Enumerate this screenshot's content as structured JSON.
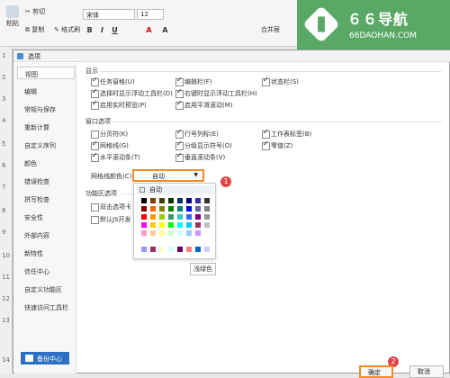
{
  "ribbon": {
    "paste": "粘贴",
    "cut": "剪切",
    "copy": "复制",
    "format_painter": "格式刷",
    "font": "宋体",
    "font_size": "12",
    "format_buttons": [
      "B",
      "I",
      "U",
      "A",
      "A"
    ],
    "merge_center": "合并居"
  },
  "watermark": {
    "title": "６６导航",
    "subtitle": "66DAOHAN.COM"
  },
  "row_numbers": [
    "1",
    "2",
    "3",
    "4",
    "5",
    "6",
    "7",
    "8",
    "9",
    "10",
    "11",
    "12",
    "13",
    "14"
  ],
  "dialog": {
    "title": "选项",
    "sidebar": [
      "视图",
      "编辑",
      "常规与保存",
      "重新计算",
      "自定义序列",
      "颜色",
      "错误检查",
      "拼写检查",
      "安全性",
      "外部内容",
      "新特性",
      "信任中心",
      "自定义功能区",
      "快速访问工具栏"
    ],
    "backup": "备份中心",
    "sections": {
      "display": "显示",
      "window": "窗口选项",
      "function": "功能区选项"
    },
    "display_options": [
      {
        "label": "任务窗格(U)",
        "checked": true
      },
      {
        "label": "编辑栏(F)",
        "checked": true
      },
      {
        "label": "状态栏(S)",
        "checked": true
      },
      {
        "label": "选择时显示浮动工具栏(D)",
        "checked": true
      },
      {
        "label": "右键时显示浮动工具栏(H)",
        "checked": true
      },
      {
        "label": "启用实时预览(P)",
        "checked": true
      },
      {
        "label": "启用平滑滚动(M)",
        "checked": true
      }
    ],
    "window_options": [
      {
        "label": "分页符(K)",
        "checked": false
      },
      {
        "label": "行号列标(E)",
        "checked": true
      },
      {
        "label": "工作表标签(B)",
        "checked": true
      },
      {
        "label": "网格线(G)",
        "checked": true
      },
      {
        "label": "分级显示符号(O)",
        "checked": true
      },
      {
        "label": "零值(Z)",
        "checked": true
      },
      {
        "label": "水平滚动条(T)",
        "checked": true
      },
      {
        "label": "垂直滚动条(V)",
        "checked": true
      }
    ],
    "gridline_color_label": "网格线颜色(C):",
    "gridline_color_value": "自动",
    "palette_auto": "自动",
    "function_options": [
      {
        "label": "双击选项卡",
        "checked": false
      },
      {
        "label": "默认JS开发",
        "checked": false
      }
    ],
    "tooltip": "浅绿色",
    "marker_1": "1",
    "marker_2": "2",
    "ok": "确定",
    "cancel": "取消"
  }
}
